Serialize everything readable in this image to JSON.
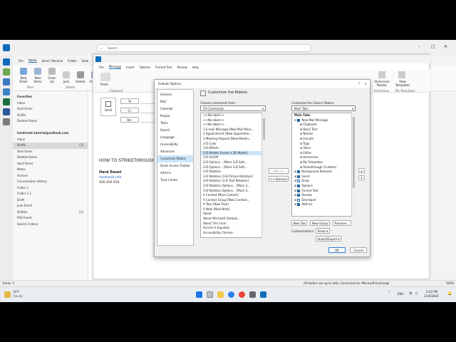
{
  "window": {
    "search_placeholder": "Search",
    "tabs": [
      "File",
      "Home",
      "Send / Receive",
      "Folder",
      "View"
    ],
    "ribbon_buttons": [
      "New Email",
      "New Items",
      "Clean Up",
      "Junk",
      "Delete",
      "Archive"
    ],
    "ribbon_groups": [
      "New",
      "Delete"
    ]
  },
  "folders": {
    "items": [
      {
        "label": "Favorites",
        "bold": true
      },
      {
        "label": "Inbox"
      },
      {
        "label": "Sent Items"
      },
      {
        "label": "Drafts"
      },
      {
        "label": "Deleted Items"
      },
      {
        "label": ""
      },
      {
        "label": "hardreset.tutorial@outlook.com",
        "bold": true
      },
      {
        "label": "Inbox"
      },
      {
        "label": "Drafts",
        "count": "[1]",
        "selected": true
      },
      {
        "label": "Sent Items"
      },
      {
        "label": "Deleted Items"
      },
      {
        "label": "Hard Reset"
      },
      {
        "label": "Notes"
      },
      {
        "label": "Archive"
      },
      {
        "label": "Conversation History"
      },
      {
        "label": "Folder 1"
      },
      {
        "label": "Folder 1.1"
      },
      {
        "label": "Draft"
      },
      {
        "label": "Junk Email"
      },
      {
        "label": "Outbox",
        "count": "[1]"
      },
      {
        "label": "RSS Feeds"
      },
      {
        "label": "Search Folders"
      }
    ]
  },
  "compose": {
    "tabs": [
      "File",
      "Message",
      "Insert",
      "Options",
      "Format Text",
      "Review",
      "Help"
    ],
    "paste_label": "Paste",
    "clipboard_label": "Clipboard",
    "send_label": "Send",
    "to_label": "To",
    "cc_label": "Cc",
    "bcc_label": "Bcc",
    "reader_label": "Immersive Reader",
    "immersive_label": "Immersive",
    "templates_label": "View Templates",
    "my_templates_label": "My Templates",
    "body_heading": "HOW TO STRIKETHROUGH",
    "sig_name": "Hard Reset",
    "sig_site": "hardreset.info",
    "sig_phone": "456 456 456"
  },
  "dialog": {
    "title": "Outlook Options",
    "heading": "Customize the Ribbon.",
    "nav": [
      "General",
      "Mail",
      "Calendar",
      "People",
      "Tasks",
      "Search",
      "Language",
      "Accessibility",
      "Advanced",
      "Customize Ribbon",
      "Quick Access Toolbar",
      "Add-ins",
      "Trust Center"
    ],
    "nav_selected_index": 9,
    "choose_label": "Choose commands from:",
    "choose_value": "All Commands",
    "commands": [
      "<<No label>>",
      "<<No label>>",
      "<<No label>>",
      "1 E-mail Message [New Mail Mess...",
      "2 Appointment [New Appointme...",
      "3 Meeting Request [New Meetin...",
      "3-D Color",
      "3-D Effects",
      "3-D Models [Insert a 3D Model]",
      "3-D On/Off",
      "3-D Options... [More 3-D Sett...",
      "3-D Options... [More 3-D Sett...",
      "3-D Rotation",
      "3-D Rotation [3-D Picture Rotation]",
      "3-D Rotation [3-D Text Rotation]",
      "3-D Rotation Options... [More 3...",
      "3-D Rotation Options... [More 3...",
      "A Contact [New Contact]",
      "A Contact Group [New Contact...",
      "A Task [New Task]",
      "A Note [New Note]",
      "About",
      "About Microsoft Outlook...",
      "About This Form",
      "Accent in Equation",
      "Accessibility Checker"
    ],
    "add_label": "Add >>",
    "remove_label": "<< Remove",
    "customize_label": "Customize the Classic Ribbon:",
    "customize_value": "Main Tabs",
    "tree_header": "Main Tabs",
    "tree": [
      {
        "label": "New Mail Message",
        "level": 0,
        "check": true,
        "expand": "⊟"
      },
      {
        "label": "Clipboard",
        "level": 1,
        "expand": "⊞"
      },
      {
        "label": "Basic Text",
        "level": 1,
        "expand": "⊞"
      },
      {
        "label": "Names",
        "level": 1,
        "expand": "⊞"
      },
      {
        "label": "Include",
        "level": 1,
        "expand": "⊞"
      },
      {
        "label": "Tags",
        "level": 1,
        "expand": "⊞"
      },
      {
        "label": "Voice",
        "level": 1,
        "expand": "⊞"
      },
      {
        "label": "Editor",
        "level": 1,
        "expand": "⊞"
      },
      {
        "label": "Immersive",
        "level": 1,
        "expand": "⊞"
      },
      {
        "label": "My Templates",
        "level": 1,
        "expand": "⊞"
      },
      {
        "label": "Strikethrough (Custom)",
        "level": 1,
        "expand": "⊞"
      },
      {
        "label": "Background Removal",
        "level": 0,
        "check": true,
        "expand": "⊞"
      },
      {
        "label": "Insert",
        "level": 0,
        "check": true,
        "expand": "⊞"
      },
      {
        "label": "Draw",
        "level": 0,
        "check": false,
        "expand": "⊞"
      },
      {
        "label": "Options",
        "level": 0,
        "check": true,
        "expand": "⊞"
      },
      {
        "label": "Format Text",
        "level": 0,
        "check": true,
        "expand": "⊞"
      },
      {
        "label": "Review",
        "level": 0,
        "check": true,
        "expand": "⊞"
      },
      {
        "label": "Developer",
        "level": 0,
        "check": false,
        "expand": "⊞"
      },
      {
        "label": "Add-ins",
        "level": 0,
        "check": true,
        "expand": "⊞"
      }
    ],
    "new_tab_label": "New Tab",
    "new_group_label": "New Group",
    "rename_label": "Rename...",
    "customizations_label": "Customizations:",
    "reset_label": "Reset ▾",
    "import_export_label": "Import/Export ▾",
    "ok_label": "OK",
    "cancel_label": "Cancel"
  },
  "status": {
    "left": "Items: 1",
    "center": "All folders are up to date.",
    "center2": "Connected to: Microsoft Exchange",
    "zoom": "100%"
  },
  "taskbar": {
    "temp": "34°F",
    "weather": "Cloudy",
    "lang": "ENG",
    "time": "2:42 PM",
    "date": "1/16/2024"
  }
}
